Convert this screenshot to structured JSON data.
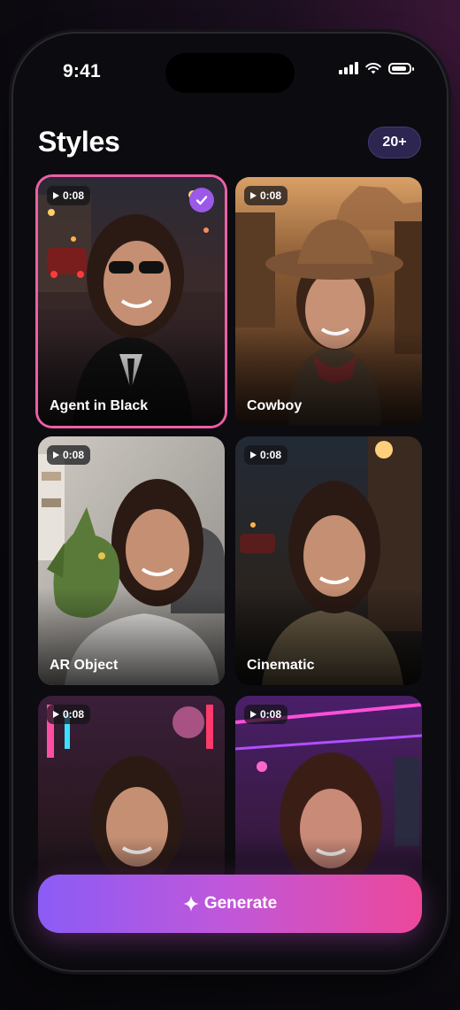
{
  "status_bar": {
    "time": "9:41"
  },
  "header": {
    "title": "Styles",
    "count_badge": "20+"
  },
  "styles": [
    {
      "label": "Agent in Black",
      "duration": "0:08",
      "selected": true
    },
    {
      "label": "Cowboy",
      "duration": "0:08",
      "selected": false
    },
    {
      "label": "AR Object",
      "duration": "0:08",
      "selected": false
    },
    {
      "label": "Cinematic",
      "duration": "0:08",
      "selected": false
    },
    {
      "label": "",
      "duration": "0:08",
      "selected": false
    },
    {
      "label": "",
      "duration": "0:08",
      "selected": false
    }
  ],
  "generate_button": {
    "label": "Generate",
    "icon": "sparkle-icon"
  },
  "colors": {
    "accent_pink": "#ec5fa6",
    "check_purple": "#9b59e8",
    "button_start": "#8b5cf6",
    "button_end": "#ec4899"
  }
}
